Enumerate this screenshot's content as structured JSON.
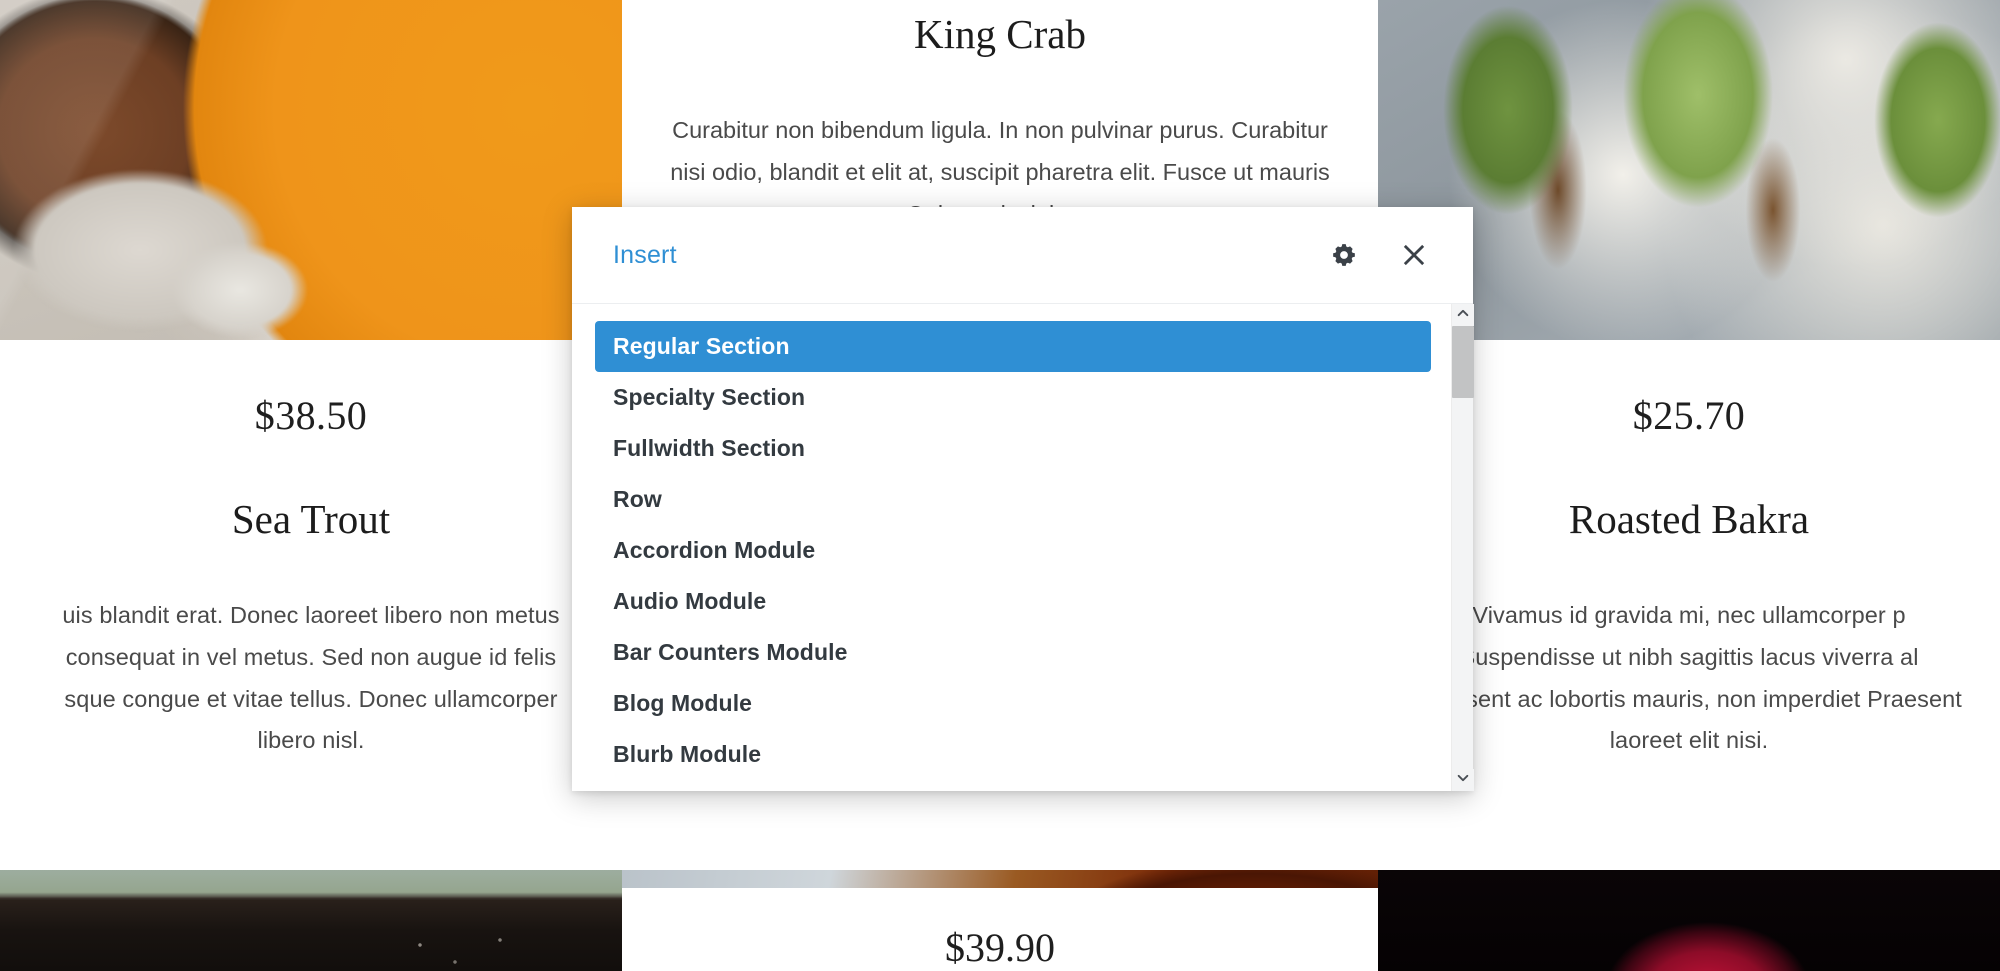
{
  "background": {
    "cards": [
      {
        "id": "sea-trout",
        "price": "$38.50",
        "title": "Sea Trout",
        "description": "uis blandit erat. Donec laoreet libero non metus consequat in vel metus. Sed non augue id felis sque congue et vitae tellus. Donec ullamcorper libero nisl.",
        "photo": "chocolate-tart-orange-knife"
      },
      {
        "id": "king-crab",
        "price": "$39.90",
        "title": "King Crab",
        "description": "Curabitur non bibendum ligula. In non pulvinar purus. Curabitur nisi odio, blandit et elit at, suscipit pharetra elit. Fusce ut mauris quam. Quisque lacinia quam eu",
        "photo": "king-crab-on-ice"
      },
      {
        "id": "roasted-bakra",
        "price": "$25.70",
        "title": "Roasted Bakra",
        "description": "Vivamus id gravida mi, nec ullamcorper p Suspendisse ut nibh sagittis lacus viverra al Praesent ac lobortis mauris, non imperdiet Praesent laoreet elit nisi.",
        "photo": "avocado-toast-greens"
      }
    ],
    "photos": {
      "top_left": "chocolate-tart-orange-knife",
      "top_right": "avocado-toast-greens",
      "bottom_left": "dark-pan-on-green-board",
      "bottom_center": "king-crab-on-ice",
      "bottom_right": "dark-red-berry"
    }
  },
  "modal": {
    "title": "Insert",
    "settings_icon": "gear-icon",
    "close_icon": "close-icon",
    "accent_color": "#2f8fd4",
    "scrollbar": {
      "up_icon": "chevron-up-icon",
      "down_icon": "chevron-down-icon",
      "thumb_position_percent": 2,
      "thumb_size_percent": 15
    },
    "items": [
      {
        "label": "Regular Section",
        "selected": true
      },
      {
        "label": "Specialty Section",
        "selected": false
      },
      {
        "label": "Fullwidth Section",
        "selected": false
      },
      {
        "label": "Row",
        "selected": false
      },
      {
        "label": "Accordion Module",
        "selected": false
      },
      {
        "label": "Audio Module",
        "selected": false
      },
      {
        "label": "Bar Counters Module",
        "selected": false
      },
      {
        "label": "Blog Module",
        "selected": false
      },
      {
        "label": "Blurb Module",
        "selected": false
      }
    ]
  }
}
